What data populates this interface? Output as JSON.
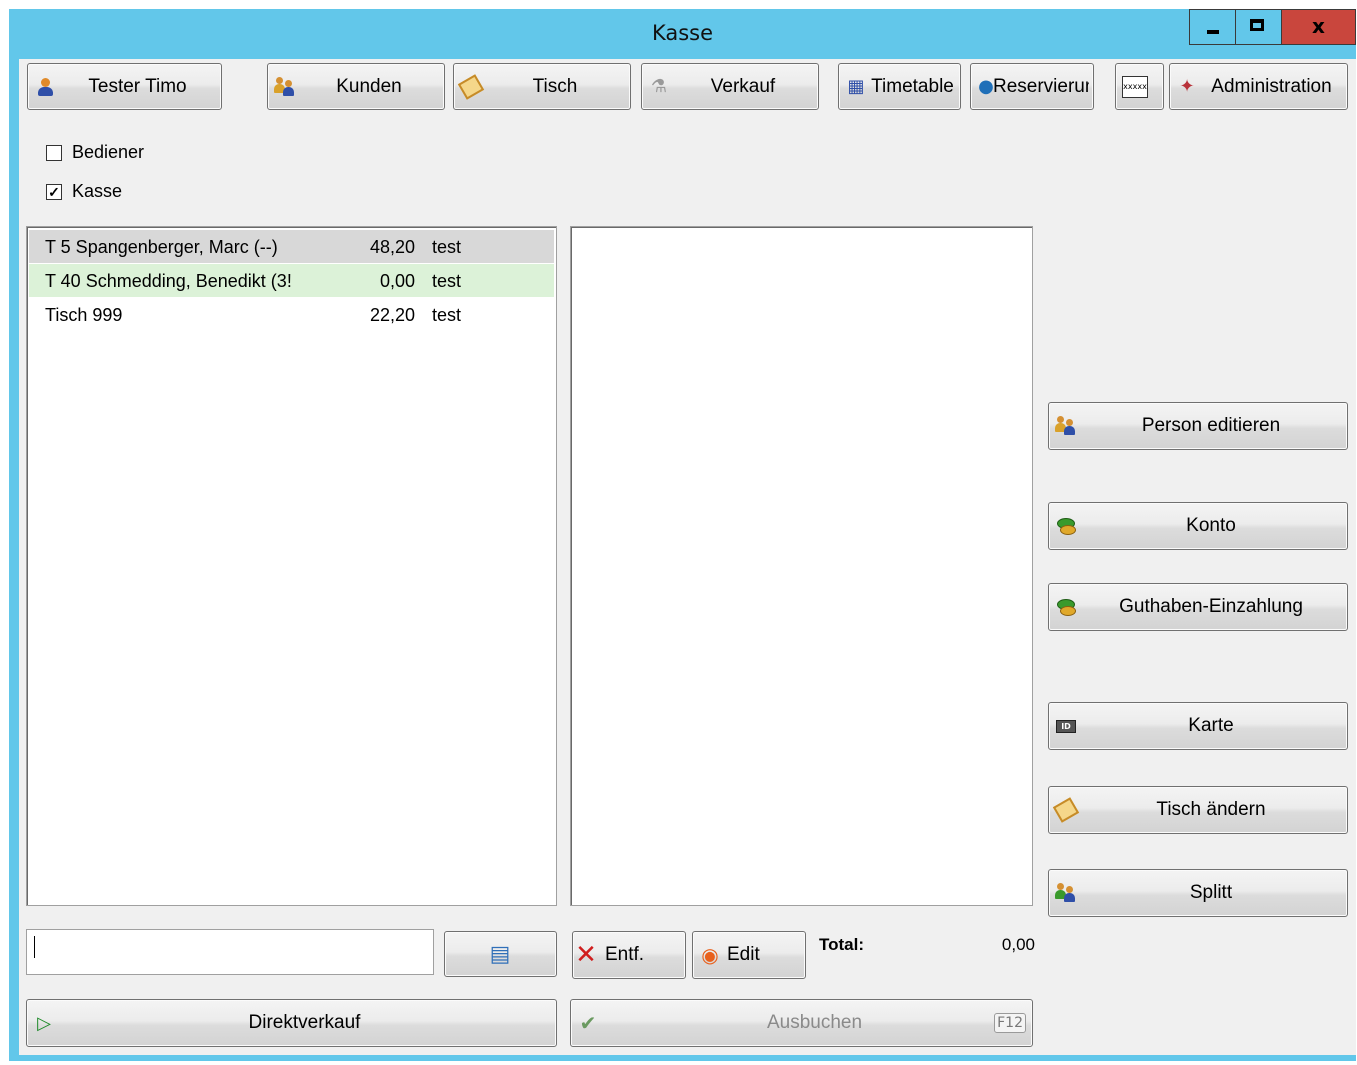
{
  "window": {
    "title": "Kasse"
  },
  "toolbar": {
    "user": "Tester Timo",
    "kunden": "Kunden",
    "tisch": "Tisch",
    "verkauf": "Verkauf",
    "timetable": "Timetable",
    "reservierung": "Reservierung",
    "administration": "Administration"
  },
  "filters": {
    "bediener": {
      "label": "Bediener",
      "checked": false
    },
    "kasse": {
      "label": "Kasse",
      "checked": true
    }
  },
  "tables": [
    {
      "name": "T  5 Spangenberger, Marc (--)",
      "amount": "48,20",
      "note": "test",
      "state": "selected"
    },
    {
      "name": "T 40 Schmedding, Benedikt (3!",
      "amount": "0,00",
      "note": "test",
      "state": "highlighted"
    },
    {
      "name": "Tisch 999",
      "amount": "22,20",
      "note": "test",
      "state": "normal"
    }
  ],
  "actions": {
    "entf": "Entf.",
    "edit": "Edit",
    "total_label": "Total:",
    "total_value": "0,00",
    "direktverkauf": "Direktverkauf",
    "ausbuchen": "Ausbuchen",
    "ausbuchen_key": "F12"
  },
  "side": {
    "person_editieren": "Person editieren",
    "konto": "Konto",
    "guthaben": "Guthaben-Einzahlung",
    "karte": "Karte",
    "tisch_aendern": "Tisch ändern",
    "splitt": "Splitt"
  },
  "colors": {
    "title_bar": "#62c7ea",
    "close_button": "#c9463d",
    "highlight_row": "#dcf2d8"
  }
}
